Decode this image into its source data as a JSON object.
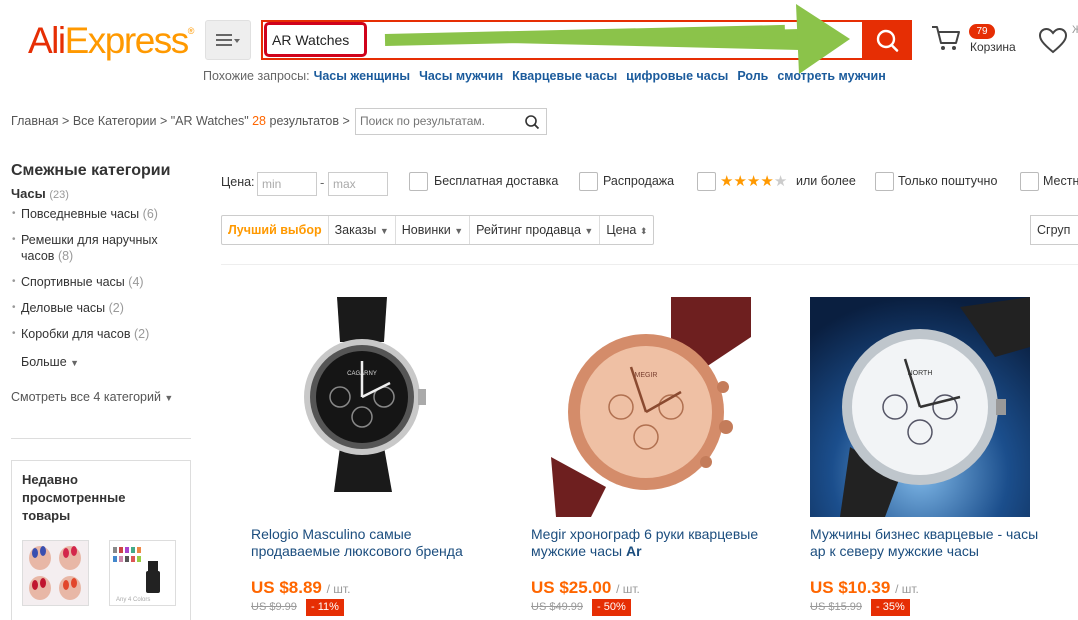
{
  "header": {
    "logo_main": "AliExpress",
    "logo_mark": "®",
    "search_value": "AR Watches",
    "cart_count": "79",
    "cart_label": "Корзина",
    "wish_label": "Ж"
  },
  "related": {
    "label": "Похожие запросы:",
    "items": [
      "Часы женщины",
      "Часы мужчин",
      "Кварцевые часы",
      "цифровые часы",
      "Роль",
      "смотреть мужчин"
    ]
  },
  "breadcrumb": {
    "home": "Главная",
    "all": "Все Категории",
    "query": "\"AR Watches\"",
    "count": "28",
    "results": "результатов",
    "search_placeholder": "Поиск по результатам."
  },
  "sidebar": {
    "title": "Смежные категории",
    "sub": "Часы",
    "sub_count": "(23)",
    "items": [
      {
        "label": "Повседневные часы",
        "count": "(6)"
      },
      {
        "label": "Ремешки для наручных часов",
        "count": "(8)"
      },
      {
        "label": "Спортивные часы",
        "count": "(4)"
      },
      {
        "label": "Деловые часы",
        "count": "(2)"
      },
      {
        "label": "Коробки для часов",
        "count": "(2)"
      }
    ],
    "more": "Больше",
    "all_cats": "Смотреть все 4 категорий",
    "recent_title": "Недавно просмотренные товары"
  },
  "filters": {
    "price_label": "Цена:",
    "min_ph": "min",
    "max_ph": "max",
    "free_ship": "Бесплатная доставка",
    "sale": "Распродажа",
    "rating_suffix": "или более",
    "rating_value": 4,
    "single": "Только поштучно",
    "local": "Местн"
  },
  "sort": {
    "best": "Лучший выбор",
    "orders": "Заказы",
    "new": "Новинки",
    "seller": "Рейтинг продавца",
    "price": "Цена",
    "group": "Сгруп"
  },
  "products": [
    {
      "title": "Relogio Masculino самые продаваемые люксового бренда",
      "price": "US $8.89",
      "unit": "/ шт.",
      "old": "US $9.99",
      "disc": "- 11%"
    },
    {
      "title": "Megir хронограф 6 руки кварцевые мужские часы",
      "title_bold": "Ar",
      "price": "US $25.00",
      "unit": "/ шт.",
      "old": "US $49.99",
      "disc": "- 50%"
    },
    {
      "title": "Мужчины бизнес кварцевые - часы ар к северу мужские часы",
      "price": "US $10.39",
      "unit": "/ шт.",
      "old": "US $15.99",
      "disc": "- 35%"
    }
  ],
  "images": {
    "watch1_brand": "CAGARNY",
    "watch2_brand": "MEGIR",
    "watch3_brand": "NORTH",
    "thumb2_caption": "Any 4 Colors"
  },
  "colors": {
    "accent": "#e62e04",
    "orange": "#ff9900",
    "link": "#1b5b9c",
    "arrow": "#8bc34a"
  }
}
